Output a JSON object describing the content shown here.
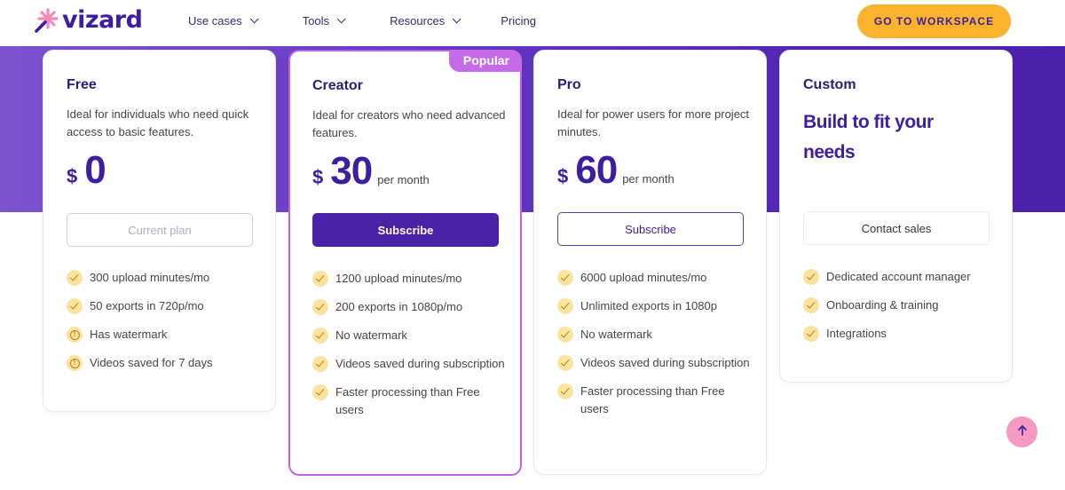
{
  "header": {
    "logo_text": "vizard",
    "nav": [
      {
        "label": "Use cases",
        "has_dropdown": true
      },
      {
        "label": "Tools",
        "has_dropdown": true
      },
      {
        "label": "Resources",
        "has_dropdown": true
      },
      {
        "label": "Pricing",
        "has_dropdown": false
      }
    ],
    "cta_label": "GO TO WORKSPACE"
  },
  "colors": {
    "brand_purple": "#3d1e9e",
    "cta_yellow": "#fbb32e",
    "popular_badge": "#c56be8",
    "feature_icon_bg": "#fbe3a0",
    "scroll_top_pink": "#f49ac0"
  },
  "plans": [
    {
      "name": "Free",
      "description": "Ideal for individuals who need quick access to basic features.",
      "currency": "$",
      "price": "0",
      "period": "",
      "button_label": "Current plan",
      "features": [
        {
          "icon": "check-icon",
          "text": "300 upload minutes/mo"
        },
        {
          "icon": "check-icon",
          "text": "50 exports in 720p/mo"
        },
        {
          "icon": "warning-icon",
          "text": "Has watermark"
        },
        {
          "icon": "warning-icon",
          "text": "Videos saved for 7 days"
        }
      ]
    },
    {
      "name": "Creator",
      "badge": "Popular",
      "description": "Ideal for creators who need advanced features.",
      "currency": "$",
      "price": "30",
      "period": "per month",
      "button_label": "Subscribe",
      "features": [
        {
          "icon": "check-icon",
          "text": "1200 upload minutes/mo"
        },
        {
          "icon": "check-icon",
          "text": "200 exports in 1080p/mo"
        },
        {
          "icon": "check-icon",
          "text": "No watermark"
        },
        {
          "icon": "check-icon",
          "text": "Videos saved during subscription"
        },
        {
          "icon": "check-icon",
          "text": "Faster processing than Free users"
        }
      ]
    },
    {
      "name": "Pro",
      "description": "Ideal for power users for more project minutes.",
      "currency": "$",
      "price": "60",
      "period": "per month",
      "button_label": "Subscribe",
      "features": [
        {
          "icon": "check-icon",
          "text": "6000 upload minutes/mo"
        },
        {
          "icon": "check-icon",
          "text": "Unlimited exports in 1080p"
        },
        {
          "icon": "check-icon",
          "text": "No watermark"
        },
        {
          "icon": "check-icon",
          "text": "Videos saved during subscription"
        },
        {
          "icon": "check-icon",
          "text": "Faster processing than Free users"
        }
      ]
    },
    {
      "name": "Custom",
      "headline": "Build to fit your needs",
      "button_label": "Contact sales",
      "features": [
        {
          "icon": "check-icon",
          "text": "Dedicated account manager"
        },
        {
          "icon": "check-icon",
          "text": "Onboarding & training"
        },
        {
          "icon": "check-icon",
          "text": "Integrations"
        }
      ]
    }
  ],
  "scroll_top": {
    "icon": "arrow-up-icon"
  }
}
